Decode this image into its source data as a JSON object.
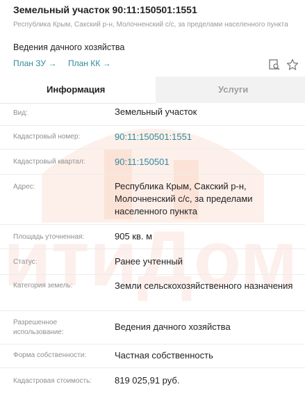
{
  "header": {
    "title": "Земельный участок 90:11:150501:1551",
    "address_line": "Республика Крым, Сакский р-н, Молочненский с/с, за пределами населенного пункта",
    "purpose": "Ведения дачного хозяйства",
    "link_plan_zu": "План ЗУ →",
    "link_plan_kk": "План КК →"
  },
  "tabs": {
    "info": "Информация",
    "services": "Услуги"
  },
  "rows": [
    {
      "label": "Вид:",
      "value": "Земельный участок"
    },
    {
      "label": "Кадастровый номер:",
      "value": "90:11:150501:1551"
    },
    {
      "label": "Кадастровый квартал:",
      "value": "90:11:150501"
    },
    {
      "label": "Адрес:",
      "value": "Республика Крым, Сакский р-н, Молочненский с/с, за пределами населенного пункта"
    },
    {
      "label": "Площадь уточненная:",
      "value": "905 кв. м"
    },
    {
      "label": "Статус:",
      "value": "Ранее учтенный"
    },
    {
      "label": "Категория земель:",
      "value": "Земли сельскохозяйственного назначения"
    },
    {
      "label": "Разрешенное использование:",
      "value": "Ведения дачного хозяйства"
    },
    {
      "label": "Форма собственности:",
      "value": "Частная собственность"
    },
    {
      "label": "Кадастровая стоимость:",
      "value": "819 025,91 руб."
    }
  ],
  "watermark": {
    "text": "итиДом",
    "color": "#f0a89a"
  },
  "colors": {
    "link": "#2e8a9c",
    "label": "#8f8f8f",
    "inactive_tab_bg": "#f2f2f2"
  },
  "icons": [
    "search-doc-icon",
    "star-icon"
  ]
}
